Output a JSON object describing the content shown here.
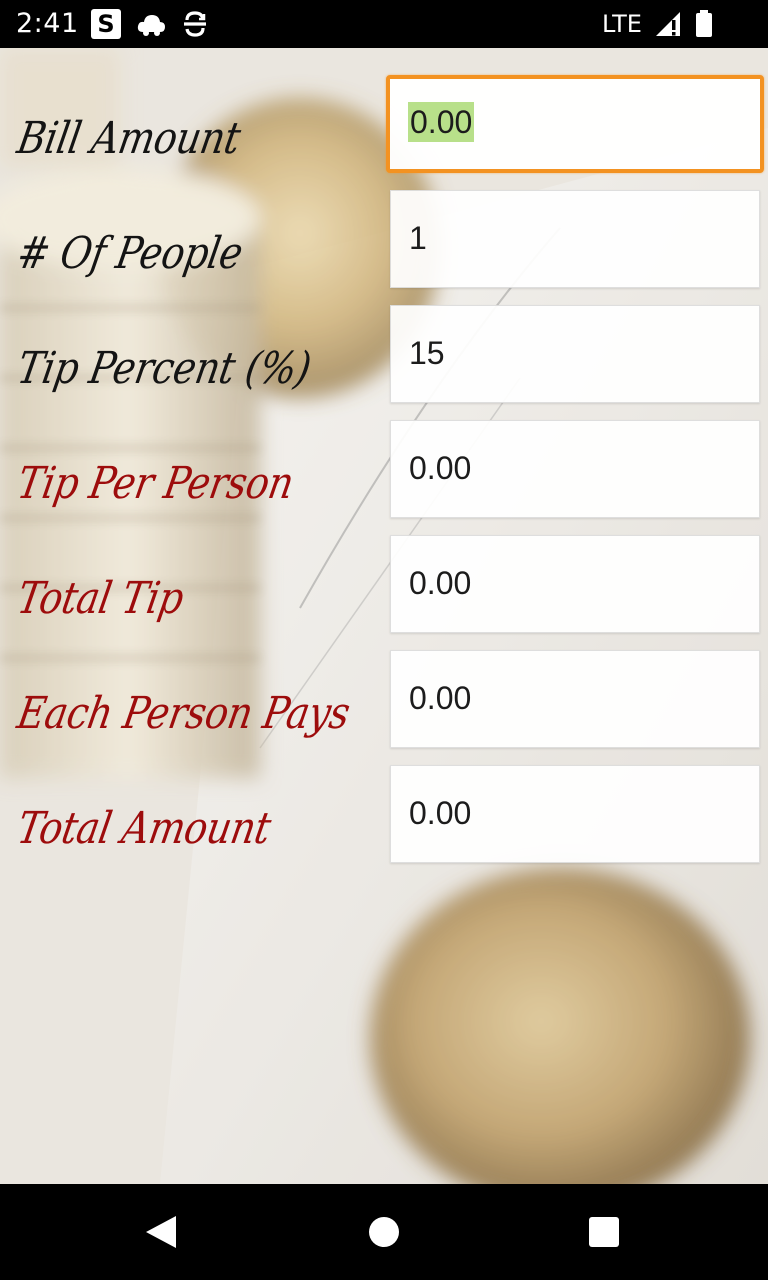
{
  "status_bar": {
    "time": "2:41",
    "s_badge": "S",
    "network": "LTE",
    "icons": [
      "s-app-icon",
      "cloud-icon",
      "sync-icon",
      "signal-icon",
      "battery-icon"
    ]
  },
  "form": {
    "inputs": [
      {
        "label": "Bill Amount",
        "value": "0.00",
        "focused": true
      },
      {
        "label": "# Of People",
        "value": "1"
      },
      {
        "label": "Tip Percent (%)",
        "value": "15"
      }
    ],
    "results": [
      {
        "label": "Tip Per Person",
        "value": "0.00"
      },
      {
        "label": "Total Tip",
        "value": "0.00"
      },
      {
        "label": "Each Person Pays",
        "value": "0.00"
      },
      {
        "label": "Total Amount",
        "value": "0.00"
      }
    ]
  },
  "colors": {
    "input_label": "#141414",
    "result_label": "#9d0c0c",
    "focus_border": "#f39221",
    "selection_highlight": "#b8e08a"
  },
  "nav_bar": {
    "icons": [
      "back-icon",
      "home-icon",
      "recents-icon"
    ]
  }
}
